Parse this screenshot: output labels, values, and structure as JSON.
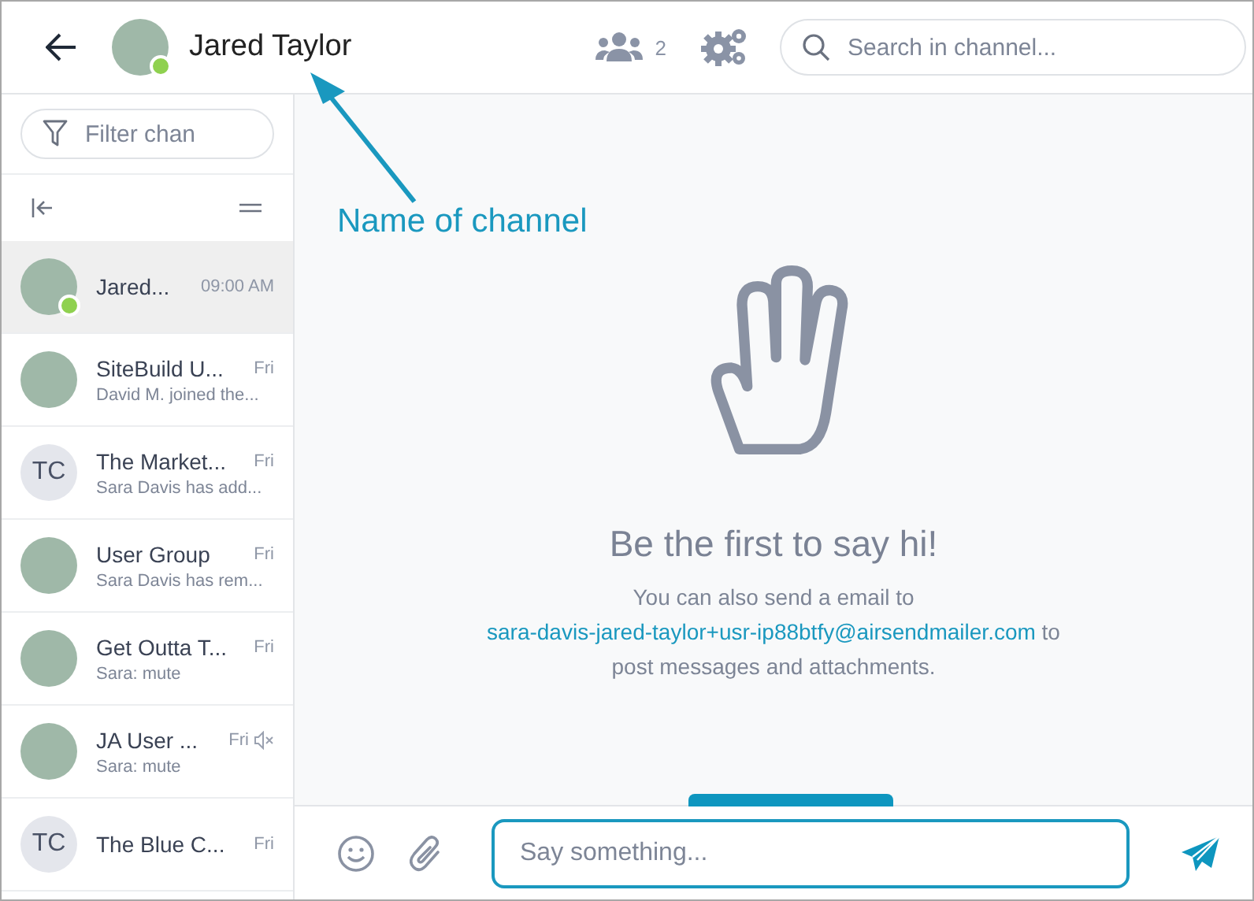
{
  "header": {
    "title": "Jared Taylor",
    "online": true,
    "member_count": "2",
    "search": {
      "placeholder": "Search in channel..."
    }
  },
  "sidebar": {
    "filter": {
      "placeholder": "Filter chan"
    },
    "channels": [
      {
        "name": "Jared...",
        "time": "09:00 AM",
        "kind": "photo",
        "selected": true,
        "online": true,
        "muted": false
      },
      {
        "name": "SiteBuild U...",
        "time": "Fri",
        "preview": "David M. joined the...",
        "kind": "photo",
        "selected": false,
        "online": false,
        "muted": false
      },
      {
        "name": "The Market...",
        "time": "Fri",
        "preview": "Sara Davis has add...",
        "kind": "initials",
        "initials": "TC",
        "selected": false,
        "online": false,
        "muted": false
      },
      {
        "name": "User Group",
        "time": "Fri",
        "preview": "Sara Davis has rem...",
        "kind": "photo",
        "selected": false,
        "online": false,
        "muted": false
      },
      {
        "name": "Get Outta T...",
        "time": "Fri",
        "preview": "Sara: mute",
        "kind": "photo",
        "selected": false,
        "online": false,
        "muted": false
      },
      {
        "name": "JA User ...",
        "time": "Fri",
        "preview": "Sara: mute",
        "kind": "photo",
        "selected": false,
        "online": false,
        "muted": true
      },
      {
        "name": "The Blue C...",
        "time": "Fri",
        "kind": "initials",
        "initials": "TC",
        "selected": false,
        "online": false,
        "muted": false
      }
    ]
  },
  "chat": {
    "empty_title": "Be the first to say hi!",
    "email_prefix": "You can also send a email to",
    "email": "sara-davis-jared-taylor+usr-ip88btfy@airsendmailer.com",
    "email_suffix": "to post messages and attachments."
  },
  "composer": {
    "placeholder": "Say something..."
  },
  "annotation": {
    "label": "Name of channel"
  }
}
